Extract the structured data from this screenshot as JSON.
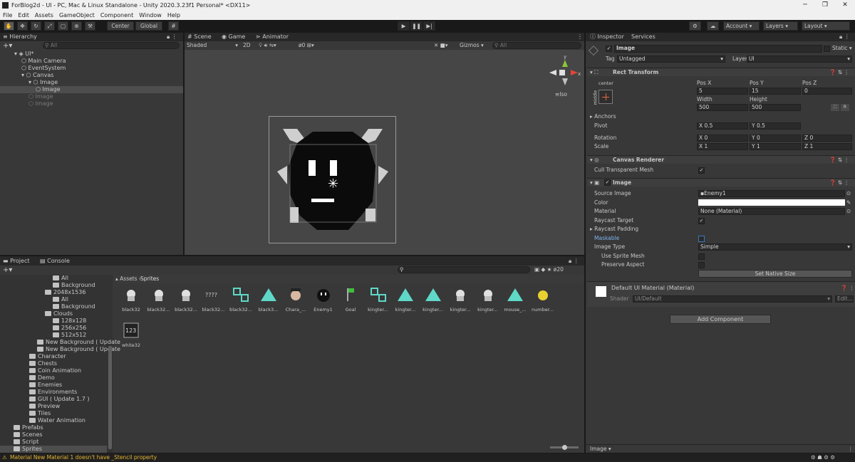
{
  "window": {
    "title": "ForBlog2d - UI - PC, Mac & Linux Standalone - Unity 2020.3.23f1 Personal* <DX11>"
  },
  "menu": [
    "File",
    "Edit",
    "Assets",
    "GameObject",
    "Component",
    "Window",
    "Help"
  ],
  "toolbar": {
    "center_label": "Center",
    "global_label": "Global",
    "account_label": "Account",
    "layers_label": "Layers",
    "layout_label": "Layout"
  },
  "hierarchy": {
    "tab": "Hierarchy",
    "search_placeholder": "All",
    "items": [
      {
        "label": "UI*",
        "indent": 0,
        "dim": false
      },
      {
        "label": "Main Camera",
        "indent": 1,
        "dim": false
      },
      {
        "label": "EventSystem",
        "indent": 1,
        "dim": false
      },
      {
        "label": "Canvas",
        "indent": 1,
        "dim": false
      },
      {
        "label": "Image",
        "indent": 2,
        "dim": false
      },
      {
        "label": "Image",
        "indent": 3,
        "dim": false
      },
      {
        "label": "Image",
        "indent": 2,
        "dim": true
      },
      {
        "label": "Image",
        "indent": 2,
        "dim": true
      }
    ]
  },
  "scene": {
    "tabs": [
      "Scene",
      "Game",
      "Animator"
    ],
    "shading": "Shaded",
    "mode_2d": "2D",
    "gizmos": "Gizmos",
    "search_placeholder": "All",
    "fx_count": "0",
    "persp": "Iso"
  },
  "project": {
    "tabs": [
      "Project",
      "Console"
    ],
    "breadcrumb": [
      "Assets",
      "Sprites"
    ],
    "hidden_count": "20",
    "search_placeholder": "",
    "folders": [
      {
        "label": "All",
        "indent": 6
      },
      {
        "label": "Background",
        "indent": 6
      },
      {
        "label": "2048x1536",
        "indent": 5
      },
      {
        "label": "All",
        "indent": 6
      },
      {
        "label": "Background",
        "indent": 6
      },
      {
        "label": "Clouds",
        "indent": 5
      },
      {
        "label": "128x128",
        "indent": 6
      },
      {
        "label": "256x256",
        "indent": 6
      },
      {
        "label": "512x512",
        "indent": 6
      },
      {
        "label": "New Background ( Update",
        "indent": 4
      },
      {
        "label": "New Background ( Update",
        "indent": 4
      },
      {
        "label": "Character",
        "indent": 3
      },
      {
        "label": "Chests",
        "indent": 3
      },
      {
        "label": "Coin Animation",
        "indent": 3
      },
      {
        "label": "Demo",
        "indent": 3
      },
      {
        "label": "Enemies",
        "indent": 3
      },
      {
        "label": "Environments",
        "indent": 3
      },
      {
        "label": "GUI ( Update 1.7 )",
        "indent": 3
      },
      {
        "label": "Preview",
        "indent": 3
      },
      {
        "label": "Tiles",
        "indent": 3
      },
      {
        "label": "Water Animation",
        "indent": 3
      },
      {
        "label": "Prefabs",
        "indent": 1
      },
      {
        "label": "Scenes",
        "indent": 1
      },
      {
        "label": "Script",
        "indent": 1
      },
      {
        "label": "Sprites",
        "indent": 1
      }
    ],
    "assets": [
      "black32",
      "black32...",
      "black32...",
      "black32...",
      "black32...",
      "black3...",
      "Chara_...",
      "Enemy1",
      "Goal",
      "kingter...",
      "kingter...",
      "kingter...",
      "kingter...",
      "kingter...",
      "mouse_...",
      "number...",
      "white32"
    ]
  },
  "inspector": {
    "tabs": [
      "Inspector",
      "Services"
    ],
    "object_name": "Image",
    "static_label": "Static",
    "tag_label": "Tag",
    "tag_value": "Untagged",
    "layer_label": "Layer",
    "layer_value": "UI",
    "rect_transform": {
      "title": "Rect Transform",
      "anchor_label": "center",
      "side_label": "middle",
      "pos_x_label": "Pos X",
      "pos_y_label": "Pos Y",
      "pos_z_label": "Pos Z",
      "pos_x": "5",
      "pos_y": "15",
      "pos_z": "0",
      "width_label": "Width",
      "height_label": "Height",
      "width": "500",
      "height": "500",
      "anchors_label": "Anchors",
      "pivot_label": "Pivot",
      "pivot_x": "0.5",
      "pivot_y": "0.5",
      "rotation_label": "Rotation",
      "rot_x": "0",
      "rot_y": "0",
      "rot_z": "0",
      "scale_label": "Scale",
      "scale_x": "1",
      "scale_y": "1",
      "scale_z": "1",
      "r_btn": "R"
    },
    "canvas_renderer": {
      "title": "Canvas Renderer",
      "cull_label": "Cull Transparent Mesh"
    },
    "image": {
      "title": "Image",
      "source_label": "Source Image",
      "source_value": "Enemy1",
      "color_label": "Color",
      "material_label": "Material",
      "material_value": "None (Material)",
      "raycast_label": "Raycast Target",
      "padding_label": "Raycast Padding",
      "maskable_label": "Maskable",
      "type_label": "Image Type",
      "type_value": "Simple",
      "sprite_mesh_label": "Use Sprite Mesh",
      "preserve_label": "Preserve Aspect",
      "native_btn": "Set Native Size"
    },
    "material": {
      "title": "Default UI Material (Material)",
      "shader_label": "Shader",
      "shader_value": "UI/Default",
      "edit_btn": "Edit..."
    },
    "add_component": "Add Component",
    "footer_label": "Image"
  },
  "status": {
    "message": "Material New Material 1 doesn't have _Stencil property"
  },
  "colors": {
    "accent": "#3a79bb",
    "warning": "#e8b530",
    "panel": "#383838",
    "header": "#282828"
  }
}
